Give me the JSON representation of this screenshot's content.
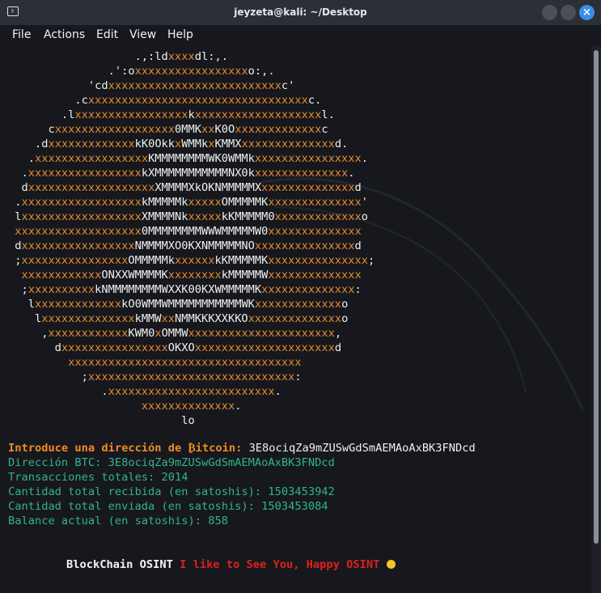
{
  "window": {
    "title": "jeyzeta@kali: ~/Desktop",
    "close_glyph": "×",
    "accent": "#3d8ee6"
  },
  "menu": [
    "File",
    "Actions",
    "Edit",
    "View",
    "Help"
  ],
  "ascii_art": [
    [
      [
        "w",
        "                   .,:ld"
      ],
      [
        "o",
        "xxxx"
      ],
      [
        "w",
        "dl:,."
      ]
    ],
    [
      [
        "w",
        "               .':o"
      ],
      [
        "o",
        "xxxxxxxxxxxxxxxxx"
      ],
      [
        "w",
        "o:,."
      ]
    ],
    [
      [
        "w",
        "            'cd"
      ],
      [
        "o",
        "xxxxxxxxxxxxxxxxxxxxxxxxxx"
      ],
      [
        "w",
        "c'"
      ]
    ],
    [
      [
        "w",
        "          .c"
      ],
      [
        "o",
        "xxxxxxxxxxxxxxxxxxxxxxxxxxxxxxxxx"
      ],
      [
        "w",
        "c."
      ]
    ],
    [
      [
        "w",
        "        .l"
      ],
      [
        "o",
        "xxxxxxxxxxxxxxxxx"
      ],
      [
        "w",
        "k"
      ],
      [
        "o",
        "xxxxxxxxxxxxxxxxxxx"
      ],
      [
        "w",
        "l."
      ]
    ],
    [
      [
        "w",
        "      c"
      ],
      [
        "o",
        "xxxxxxxxxxxxxxxxxx"
      ],
      [
        "w",
        "0MMK"
      ],
      [
        "o",
        "xx"
      ],
      [
        "w",
        "K0O"
      ],
      [
        "o",
        "xxxxxxxxxxxxx"
      ],
      [
        "w",
        "c"
      ]
    ],
    [
      [
        "w",
        "    .d"
      ],
      [
        "o",
        "xxxxxxxxxxxxx"
      ],
      [
        "w",
        "kK0Okk"
      ],
      [
        "o",
        "x"
      ],
      [
        "w",
        "WMMk"
      ],
      [
        "o",
        "x"
      ],
      [
        "w",
        "KMMX"
      ],
      [
        "o",
        "xxxxxxxxxxxxxx"
      ],
      [
        "w",
        "d."
      ]
    ],
    [
      [
        "w",
        "   ."
      ],
      [
        "o",
        "xxxxxxxxxxxxxxxxx"
      ],
      [
        "w",
        "KMMMMMMMMWK0WMMk"
      ],
      [
        "o",
        "xxxxxxxxxxxxxxxx"
      ],
      [
        "w",
        "."
      ]
    ],
    [
      [
        "w",
        "  ."
      ],
      [
        "o",
        "xxxxxxxxxxxxxxxxx"
      ],
      [
        "w",
        "kXMMMMMMMMMMMNX0k"
      ],
      [
        "o",
        "xxxxxxxxxxxxxx"
      ],
      [
        "w",
        "."
      ]
    ],
    [
      [
        "w",
        "  d"
      ],
      [
        "o",
        "xxxxxxxxxxxxxxxxxxx"
      ],
      [
        "w",
        "XMMMMXkOKNMMMMMX"
      ],
      [
        "o",
        "xxxxxxxxxxxxxx"
      ],
      [
        "w",
        "d"
      ]
    ],
    [
      [
        "w",
        " ."
      ],
      [
        "o",
        "xxxxxxxxxxxxxxxxxx"
      ],
      [
        "w",
        "kMMMMMk"
      ],
      [
        "o",
        "xxxxx"
      ],
      [
        "w",
        "OMMMMMK"
      ],
      [
        "o",
        "xxxxxxxxxxxxxx"
      ],
      [
        "w",
        "'"
      ]
    ],
    [
      [
        "w",
        " l"
      ],
      [
        "o",
        "xxxxxxxxxxxxxxxxxx"
      ],
      [
        "w",
        "XMMMMNk"
      ],
      [
        "o",
        "xxxxx"
      ],
      [
        "w",
        "kKMMMMM0"
      ],
      [
        "o",
        "xxxxxxxxxxxxx"
      ],
      [
        "w",
        "o"
      ]
    ],
    [
      [
        "w",
        " "
      ],
      [
        "o",
        "xxxxxxxxxxxxxxxxxxx"
      ],
      [
        "w",
        "0MMMMMMMMWWWMMMMMW0"
      ],
      [
        "o",
        "xxxxxxxxxxxxxx"
      ]
    ],
    [
      [
        "w",
        " d"
      ],
      [
        "o",
        "xxxxxxxxxxxxxxxxx"
      ],
      [
        "w",
        "NMMMMXO0KXNMMMMMNO"
      ],
      [
        "o",
        "xxxxxxxxxxxxxxx"
      ],
      [
        "w",
        "d"
      ]
    ],
    [
      [
        "w",
        " ;"
      ],
      [
        "o",
        "xxxxxxxxxxxxxxxx"
      ],
      [
        "w",
        "OMMMMMk"
      ],
      [
        "o",
        "xxxxxx"
      ],
      [
        "w",
        "kKMMMMMK"
      ],
      [
        "o",
        "xxxxxxxxxxxxxxx"
      ],
      [
        "w",
        ";"
      ]
    ],
    [
      [
        "w",
        "  "
      ],
      [
        "o",
        "xxxxxxxxxxxx"
      ],
      [
        "w",
        "ONXXWMMMMK"
      ],
      [
        "o",
        "xxxxxxxx"
      ],
      [
        "w",
        "kMMMMMW"
      ],
      [
        "o",
        "xxxxxxxxxxxxxx"
      ]
    ],
    [
      [
        "w",
        "  ;"
      ],
      [
        "o",
        "xxxxxxxxxx"
      ],
      [
        "w",
        "kNMMMMMMMMWXXK00KXWMMMMMK"
      ],
      [
        "o",
        "xxxxxxxxxxxxxx"
      ],
      [
        "w",
        ":"
      ]
    ],
    [
      [
        "w",
        "   l"
      ],
      [
        "o",
        "xxxxxxxxxxxxx"
      ],
      [
        "w",
        "kO0WMMWMMMMMMMMMMMWK"
      ],
      [
        "o",
        "xxxxxxxxxxxxx"
      ],
      [
        "w",
        "o"
      ]
    ],
    [
      [
        "w",
        "    l"
      ],
      [
        "o",
        "xxxxxxxxxxxxxx"
      ],
      [
        "w",
        "kMMW"
      ],
      [
        "o",
        "xx"
      ],
      [
        "w",
        "NMMKKKXXKKO"
      ],
      [
        "o",
        "xxxxxxxxxxxxxx"
      ],
      [
        "w",
        "o"
      ]
    ],
    [
      [
        "w",
        "     ,"
      ],
      [
        "o",
        "xxxxxxxxxxxx"
      ],
      [
        "w",
        "KWM0"
      ],
      [
        "o",
        "x"
      ],
      [
        "w",
        "OMMW"
      ],
      [
        "o",
        "xxxxxxxxxxxxxxxxxxxxxx"
      ],
      [
        "w",
        ","
      ]
    ],
    [
      [
        "w",
        "       d"
      ],
      [
        "o",
        "xxxxxxxxxxxxxxxx"
      ],
      [
        "w",
        "OKXO"
      ],
      [
        "o",
        "xxxxxxxxxxxxxxxxxxxxx"
      ],
      [
        "w",
        "d"
      ]
    ],
    [
      [
        "w",
        "         "
      ],
      [
        "o",
        "xxxxxxxxxxxxxxxxxxxxxxxxxxxxxxxxxxx"
      ]
    ],
    [
      [
        "w",
        "           ;"
      ],
      [
        "o",
        "xxxxxxxxxxxxxxxxxxxxxxxxxxxxxxx"
      ],
      [
        "w",
        ":"
      ]
    ],
    [
      [
        "w",
        "              ."
      ],
      [
        "o",
        "xxxxxxxxxxxxxxxxxxxxxxxxx"
      ],
      [
        "w",
        "."
      ]
    ],
    [
      [
        "w",
        "                    "
      ],
      [
        "o",
        "xxxxxxxxxxxxxx"
      ],
      [
        "w",
        "."
      ]
    ],
    [
      [
        "w",
        "                          lo"
      ]
    ]
  ],
  "prompt": {
    "label": "Introduce una dirección de ₿itcoin:",
    "value": "3E8ociqZa9mZUSwGdSmAEMAoAxBK3FNDcd"
  },
  "results": [
    "Dirección BTC: 3E8ociqZa9mZUSwGdSmAEMAoAxBK3FNDcd",
    "Transacciones totales: 2014",
    "Cantidad total recibida (en satoshis): 1503453942",
    "Cantidad total enviada (en satoshis): 1503453084",
    "Balance actual (en satoshis): 858"
  ],
  "footer": {
    "brand": "BlockChain OSINT",
    "message": "I like to See You, Happy OSINT"
  },
  "colors": {
    "orange": "#e58a2e",
    "teal": "#35b28f",
    "red": "#e0201a",
    "background": "#16181d"
  }
}
